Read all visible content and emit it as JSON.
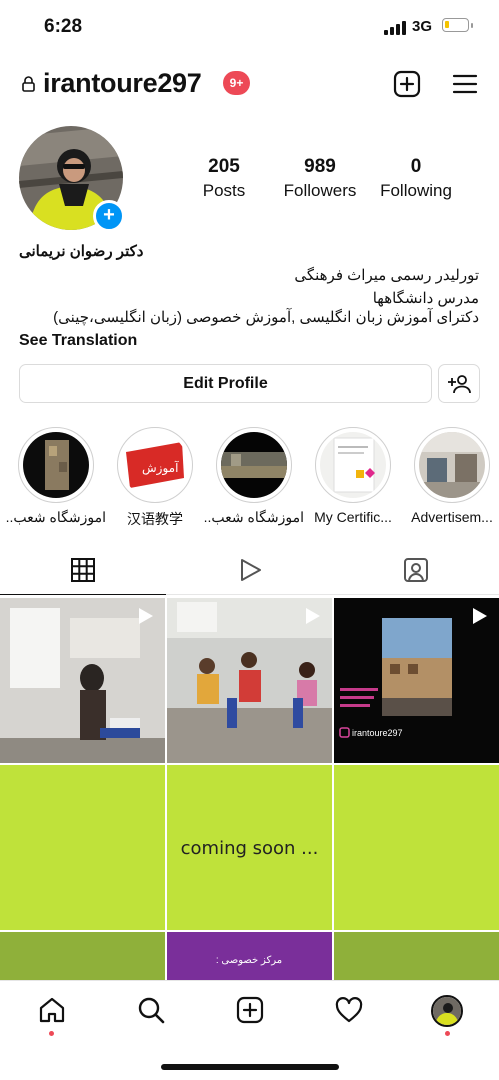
{
  "status": {
    "time": "6:28",
    "network": "3G"
  },
  "header": {
    "username": "irantoure297",
    "notif_badge": "9+"
  },
  "profile": {
    "stats": [
      {
        "num": "205",
        "label": "Posts"
      },
      {
        "num": "989",
        "label": "Followers"
      },
      {
        "num": "0",
        "label": "Following"
      }
    ],
    "bio_name": "دکتر رضوان نریمانی",
    "bio_lines": [
      "تورلیدر رسمی میراث فرهنگی",
      "مدرس دانشگاهها",
      "دکترای آموزش زبان انگلیسی ,آموزش خصوصی (زبان انگلیسی،چینی)"
    ],
    "see_translation": "See Translation",
    "edit_profile": "Edit Profile"
  },
  "highlights": [
    {
      "label": "اموزشگاه شعب..."
    },
    {
      "label": "汉语教学",
      "cover_text": "آموزش"
    },
    {
      "label": "اموزشگاه شعب..."
    },
    {
      "label": "My Certific..."
    },
    {
      "label": "Advertisem..."
    }
  ],
  "posts": {
    "coming_soon": "coming soon ...",
    "purple_text": ": مرکز خصوصی",
    "handle_tag": "irantoure297"
  },
  "colors": {
    "accent": "#0095f6",
    "badge": "#ed4956",
    "lime": "#bfe23a",
    "purple": "#7a2f9a"
  }
}
